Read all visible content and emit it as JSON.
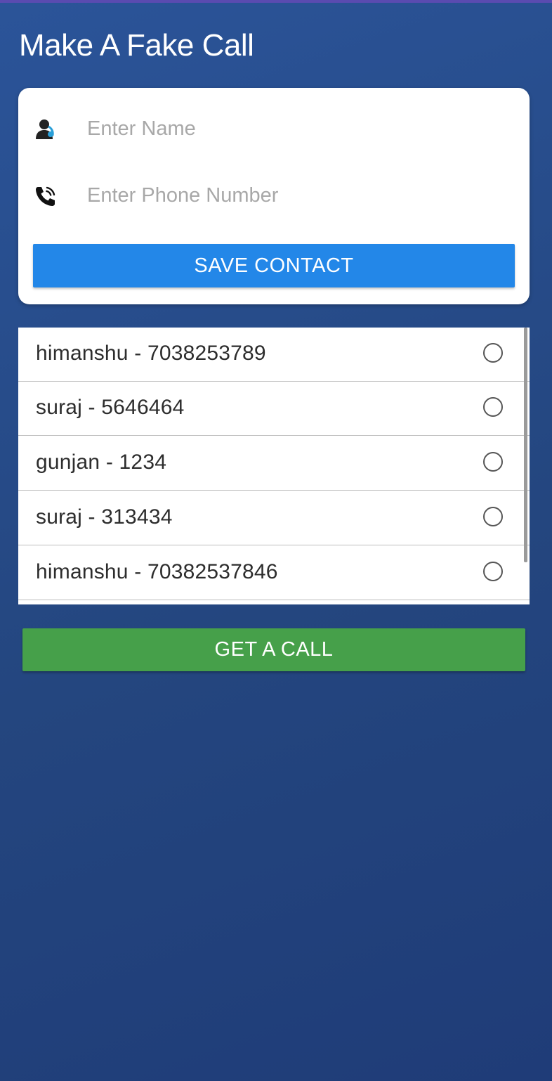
{
  "app": {
    "title": "Make A Fake Call"
  },
  "form": {
    "name_placeholder": "Enter Name",
    "name_value": "",
    "phone_placeholder": "Enter Phone Number",
    "phone_value": "",
    "name_icon": "contact-person-icon",
    "phone_icon": "phone-call-icon",
    "save_label": "SAVE CONTACT"
  },
  "contacts": [
    {
      "label": "himanshu - 7038253789",
      "selected": false
    },
    {
      "label": "suraj - 5646464",
      "selected": false
    },
    {
      "label": "gunjan - 1234",
      "selected": false
    },
    {
      "label": "suraj - 313434",
      "selected": false
    },
    {
      "label": "himanshu - 70382537846",
      "selected": false
    }
  ],
  "actions": {
    "call_label": "GET A CALL"
  },
  "colors": {
    "background": "#24467f",
    "save_button": "#2387e8",
    "call_button": "#46a04a",
    "icon_accent": "#2a9fd8"
  }
}
